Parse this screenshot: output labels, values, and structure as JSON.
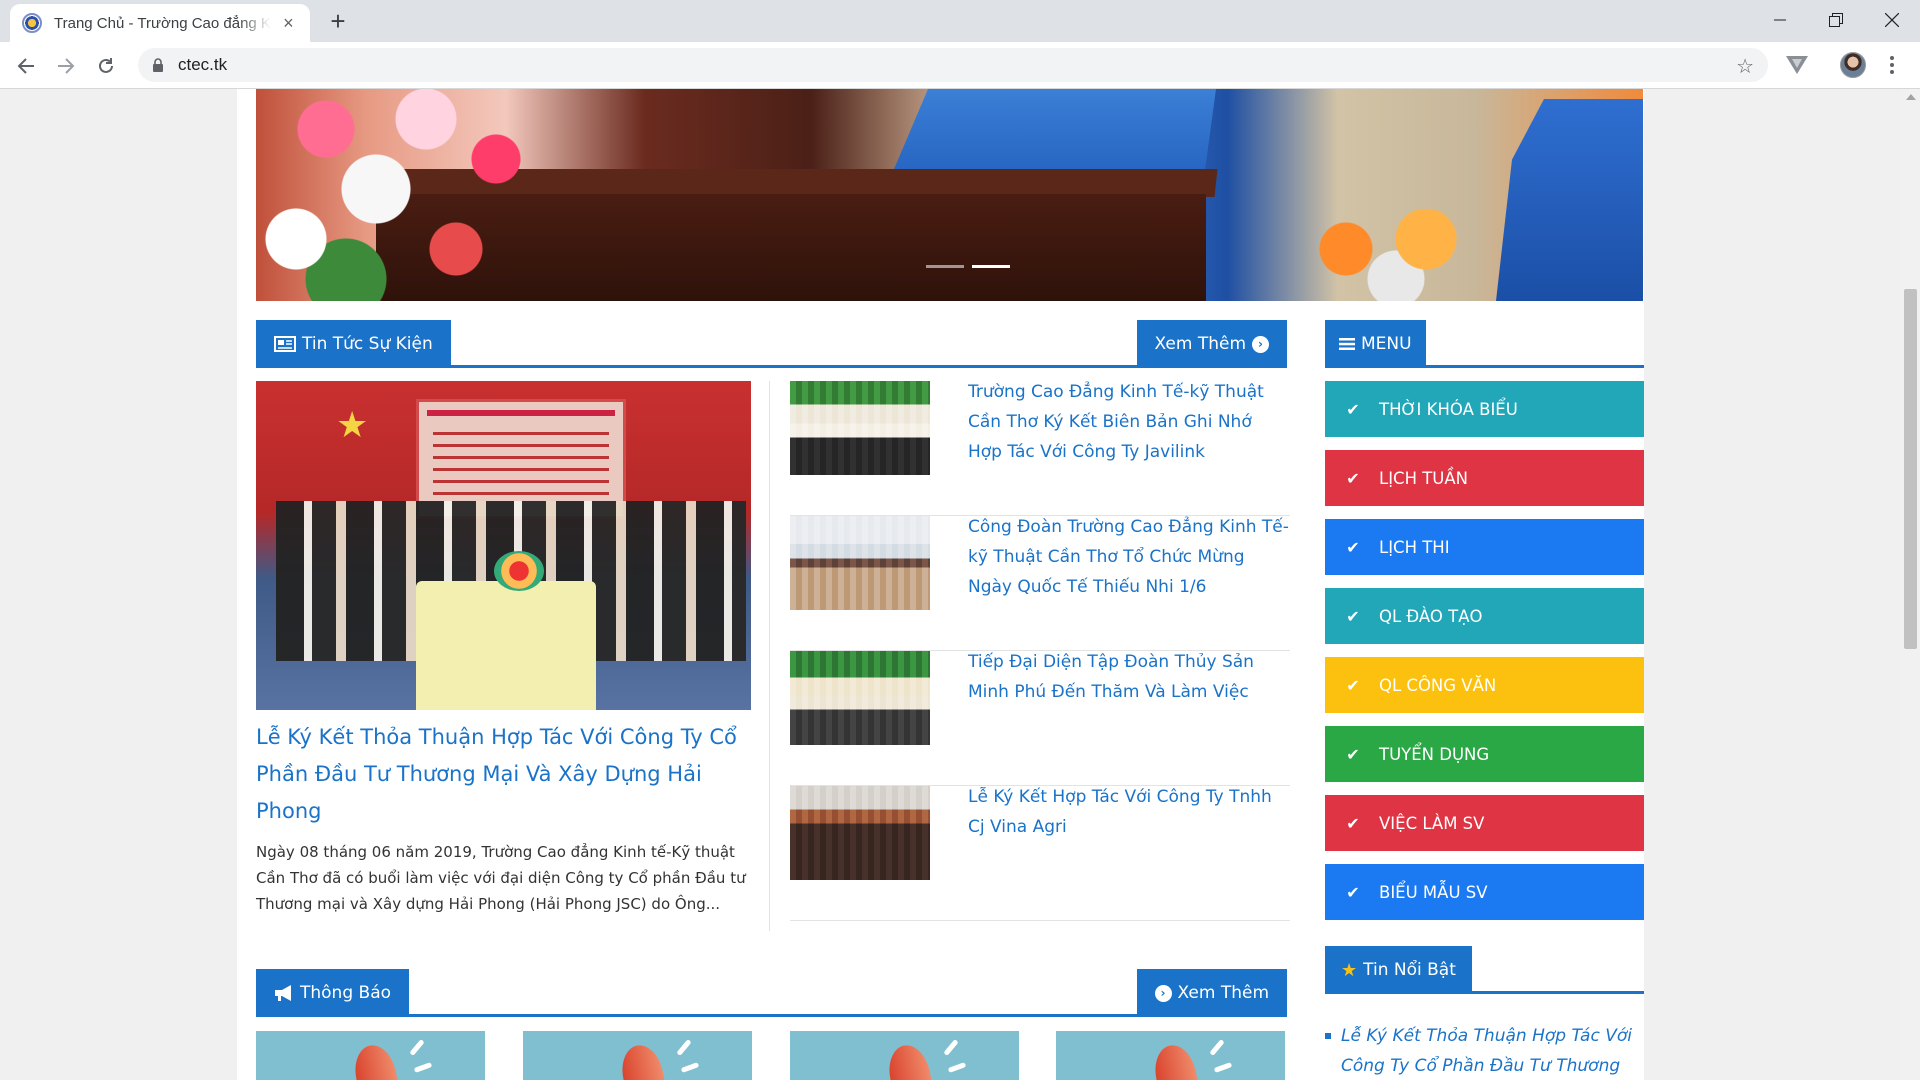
{
  "browser": {
    "tab_title": "Trang Chủ - Trường Cao đẳng Kinh tế",
    "tab_close": "×",
    "new_tab": "+",
    "url": "ctec.tk",
    "star": "☆"
  },
  "news_section": {
    "title": "Tin Tức Sự Kiện",
    "more_label": "Xem Thêm",
    "featured": {
      "title": "Lễ Ký Kết Thỏa Thuận Hợp Tác Với Công Ty Cổ Phần Đầu Tư Thương Mại Và Xây Dựng Hải Phong",
      "description": "Ngày 08 tháng 06 năm 2019, Trường Cao đẳng Kinh tế-Kỹ thuật Cần Thơ đã có buổi làm việc với đại diện Công ty Cổ phần Đầu tư Thương mại và Xây dựng Hải Phong (Hải Phong JSC) do Ông..."
    },
    "items": [
      {
        "title": "Trường Cao Đẳng Kinh Tế-kỹ Thuật Cần Thơ Ký Kết Biên Bản Ghi Nhớ Hợp Tác Với Công Ty Javilink"
      },
      {
        "title": "Công Đoàn Trường Cao Đẳng Kinh Tế-kỹ Thuật Cần Thơ Tổ Chức Mừng Ngày Quốc Tế Thiếu Nhi 1/6"
      },
      {
        "title": "Tiếp Đại Diện Tập Đoàn Thủy Sản Minh Phú Đến Thăm Và Làm Việc"
      },
      {
        "title": "Lễ Ký Kết Hợp Tác Với Công Ty Tnhh Cj Vina Agri"
      }
    ]
  },
  "notice_section": {
    "title": "Thông Báo",
    "more_label": "Xem Thêm"
  },
  "sidebar": {
    "menu_title": "MENU",
    "menu_items": [
      {
        "label": "THỜI KHÓA BIỂU",
        "color": "#21a7b8"
      },
      {
        "label": "LỊCH TUẦN",
        "color": "#de3444"
      },
      {
        "label": "LỊCH THI",
        "color": "#1b7af2"
      },
      {
        "label": "QL ĐÀO TẠO",
        "color": "#21a7b8"
      },
      {
        "label": "QL CÔNG VĂN",
        "color": "#fcc10f"
      },
      {
        "label": "TUYỂN DỤNG",
        "color": "#2aa845"
      },
      {
        "label": "VIỆC LÀM SV",
        "color": "#de3444"
      },
      {
        "label": "BIỂU MẪU SV",
        "color": "#1b7af2"
      }
    ],
    "featured_title": "Tin Nổi Bật",
    "featured_items": [
      {
        "title": "Lễ Ký Kết Thỏa Thuận Hợp Tác Với Công Ty Cổ Phần Đầu Tư Thương Mại"
      }
    ]
  },
  "icons": {
    "news": "newspaper-icon",
    "more": "chevron-circle-right-icon",
    "menu": "bars-icon",
    "check": "check-icon",
    "star": "star-icon",
    "bullhorn": "bullhorn-icon"
  },
  "colors": {
    "accent": "#1a73c9"
  }
}
